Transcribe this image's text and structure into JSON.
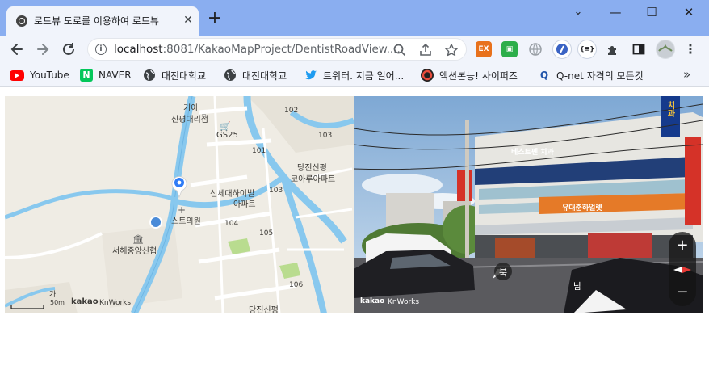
{
  "tab": {
    "title": "로드뷰 도로를 이용하여 로드뷰",
    "close": "✕"
  },
  "window": {
    "new_tab": "+",
    "dropdown": "⌄",
    "minimize": "—",
    "maximize": "☐",
    "close": "✕"
  },
  "address": {
    "host": "localhost",
    "path": ":8081/KakaoMapProject/DentistRoadView....",
    "info": "i"
  },
  "extensions": [
    {
      "label": "EX",
      "color": "#e8711c"
    },
    {
      "label": "▣",
      "color": "#2cae4a"
    }
  ],
  "bookmarks": [
    {
      "label": "YouTube",
      "icon": "youtube-icon",
      "color": "#ff0000"
    },
    {
      "label": "NAVER",
      "icon": "naver-icon",
      "color": "#03c75a"
    },
    {
      "label": "대진대학교",
      "icon": "globe-icon",
      "color": "#3c4043"
    },
    {
      "label": "대진대학교",
      "icon": "globe-icon",
      "color": "#3c4043"
    },
    {
      "label": "트위터. 지금 일어...",
      "icon": "twitter-icon",
      "color": "#1d9bf0"
    },
    {
      "label": "액션본능! 사이퍼즈",
      "icon": "cyphers-icon",
      "color": "#c0392b"
    },
    {
      "label": "Q-net 자격의 모든것",
      "icon": "qnet-icon",
      "color": "#2255aa"
    }
  ],
  "map": {
    "labels": {
      "kia": "기아",
      "kia_branch": "신평대리점",
      "gs25": "GS25",
      "b101": "101",
      "b102": "102",
      "b103": "103",
      "b104": "104",
      "b105": "105",
      "b106": "106",
      "danjin1": "당진신평",
      "coaru": "코아루아파트",
      "shinsegae": "신세대하이빌",
      "apt": "아파트",
      "sb103": "103",
      "clinic": "스트의원",
      "church": "서해중앙신협",
      "danjin2": "당진신평",
      "ga": "가",
      "scale": "50m"
    },
    "attribution": "kakao",
    "attribution_suffix": "KnWorks"
  },
  "roadview": {
    "sign_dentist": "베스트펜 치과",
    "sign_mart": "유대준하얼렛",
    "sign_vertical": "치과",
    "north_label": "북",
    "south_label": "남",
    "zoom_in": "+",
    "zoom_out": "−",
    "attribution": "kakao",
    "attribution_suffix": "KnWorks"
  },
  "colors": {
    "titlebar": "#8aaef0",
    "toolbar": "#f1f4fb",
    "road": "#88c8ee",
    "map_bg": "#efece4",
    "marker": "#2f7cf6"
  }
}
